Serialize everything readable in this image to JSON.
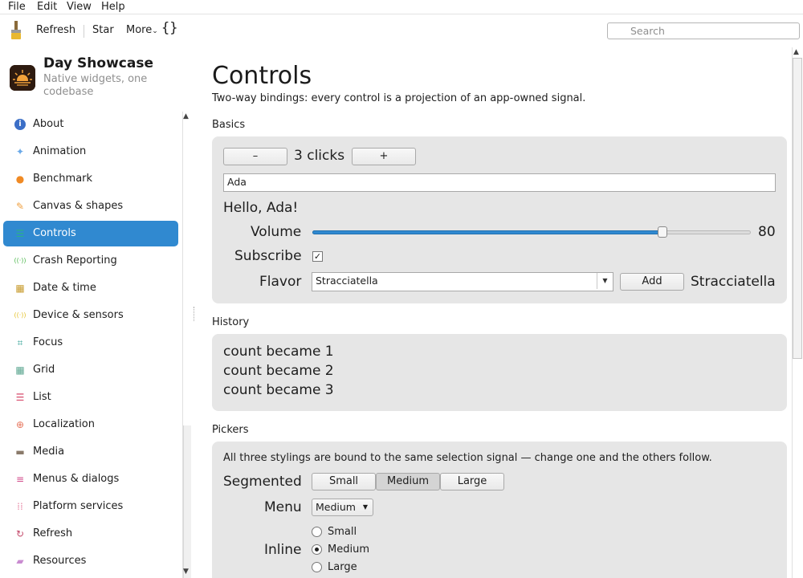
{
  "menubar": {
    "file": "File",
    "edit": "Edit",
    "view": "View",
    "help": "Help"
  },
  "toolbar": {
    "refresh": "Refresh",
    "star": "Star",
    "more": "More",
    "more_caret": "⌄",
    "braces": "{}",
    "search_placeholder": "Search"
  },
  "app": {
    "title": "Day Showcase",
    "subtitle": "Native widgets, one codebase"
  },
  "sidebar": {
    "items": [
      {
        "label": "About",
        "icon": "info-icon",
        "glyph": "i",
        "color": "#3c6fc7"
      },
      {
        "label": "Animation",
        "icon": "sparkle-icon",
        "glyph": "✦",
        "color": "#6aa9e8"
      },
      {
        "label": "Benchmark",
        "icon": "gauge-icon",
        "glyph": "●",
        "color": "#f08a24"
      },
      {
        "label": "Canvas & shapes",
        "icon": "brush-icon",
        "glyph": "✎",
        "color": "#f0a040"
      },
      {
        "label": "Controls",
        "icon": "sliders-icon",
        "glyph": "☰",
        "color": "#2ab08a"
      },
      {
        "label": "Crash Reporting",
        "icon": "signal-icon",
        "glyph": "((·))",
        "color": "#4fb84f"
      },
      {
        "label": "Date & time",
        "icon": "calendar-icon",
        "glyph": "▦",
        "color": "#c79a2b"
      },
      {
        "label": "Device & sensors",
        "icon": "sensor-icon",
        "glyph": "((·))",
        "color": "#e4c22b"
      },
      {
        "label": "Focus",
        "icon": "focus-icon",
        "glyph": "⌗",
        "color": "#3aa59a"
      },
      {
        "label": "Grid",
        "icon": "grid-icon",
        "glyph": "▦",
        "color": "#5aa58f"
      },
      {
        "label": "List",
        "icon": "list-icon",
        "glyph": "☰",
        "color": "#d74a6b"
      },
      {
        "label": "Localization",
        "icon": "globe-icon",
        "glyph": "⊕",
        "color": "#e6735a"
      },
      {
        "label": "Media",
        "icon": "film-icon",
        "glyph": "▬",
        "color": "#8a7a6a"
      },
      {
        "label": "Menus & dialogs",
        "icon": "menu-icon",
        "glyph": "≡",
        "color": "#d14a8a"
      },
      {
        "label": "Platform services",
        "icon": "dots-grid-icon",
        "glyph": "⁞⁞",
        "color": "#e88aa8"
      },
      {
        "label": "Refresh",
        "icon": "refresh-icon",
        "glyph": "↻",
        "color": "#c44a6b"
      },
      {
        "label": "Resources",
        "icon": "folder-icon",
        "glyph": "▰",
        "color": "#c98bd0"
      }
    ],
    "active_index": 4
  },
  "main": {
    "title": "Controls",
    "lead": "Two-way bindings: every control is a projection of an app-owned signal.",
    "basics": {
      "section": "Basics",
      "minus": "–",
      "plus": "+",
      "clicks": "3 clicks",
      "name_value": "Ada",
      "greeting": "Hello, Ada!",
      "volume_label": "Volume",
      "volume_value": "80",
      "volume_fraction": 0.8,
      "subscribe_label": "Subscribe",
      "subscribe_check": "✓",
      "flavor_label": "Flavor",
      "flavor_value": "Stracciatella",
      "add": "Add",
      "flavor_display": "Stracciatella"
    },
    "history": {
      "section": "History",
      "lines": [
        "count became 1",
        "count became 2",
        "count became 3"
      ]
    },
    "pickers": {
      "section": "Pickers",
      "desc": "All three stylings are bound to the same selection signal — change one and the others follow.",
      "segmented_label": "Segmented",
      "segments": [
        "Small",
        "Medium",
        "Large"
      ],
      "menu_label": "Menu",
      "menu_value": "Medium",
      "inline_label": "Inline",
      "radios": [
        "Small",
        "Medium",
        "Large"
      ],
      "selected": "Medium"
    }
  }
}
